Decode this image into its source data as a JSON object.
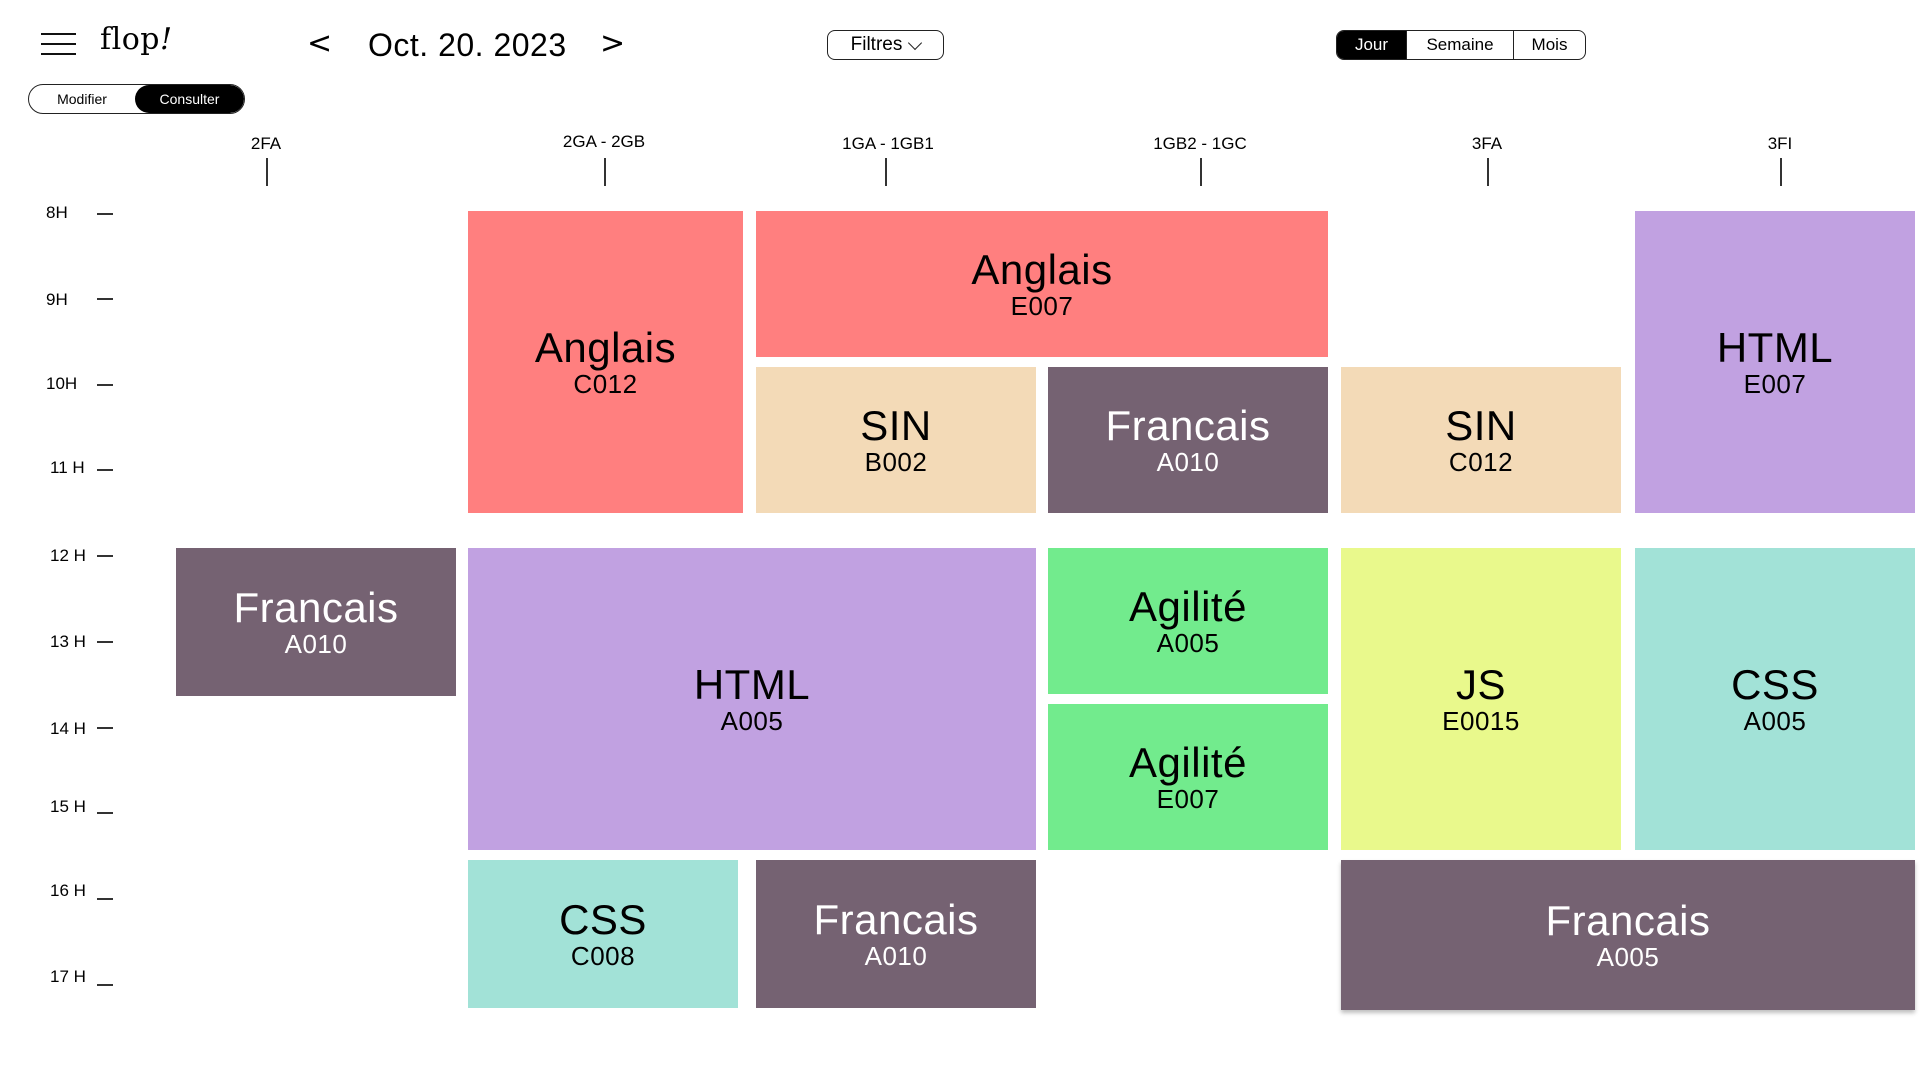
{
  "app": {
    "logo_text": "flop",
    "logo_mark": "!"
  },
  "header": {
    "prev_label": "<",
    "next_label": ">",
    "date": "Oct. 20. 2023",
    "filter_label": "Filtres",
    "views": {
      "day": "Jour",
      "week": "Semaine",
      "month": "Mois",
      "active": "Jour"
    },
    "modes": {
      "edit": "Modifier",
      "view": "Consulter",
      "active": "Consulter"
    }
  },
  "groups": [
    "2FA",
    "2GA - 2GB",
    "1GA - 1GB1",
    "1GB2 - 1GC",
    "3FA",
    "3FI"
  ],
  "hours": [
    "8H",
    "9H",
    "10H",
    "11 H",
    "12 H",
    "13 H",
    "14 H",
    "15 H",
    "16 H",
    "17 H"
  ],
  "events": [
    {
      "subject": "Anglais",
      "room": "C012",
      "group": "2GA - 2GB",
      "color": "#ff7f7f"
    },
    {
      "subject": "Anglais",
      "room": "E007",
      "group": "1GA - 1GB1, 1GB2 - 1GC",
      "color": "#ff7f7f"
    },
    {
      "subject": "HTML",
      "room": "E007",
      "group": "3FI",
      "color": "#c1a1e1"
    },
    {
      "subject": "SIN",
      "room": "B002",
      "group": "1GA - 1GB1",
      "color": "#f3dab7"
    },
    {
      "subject": "Francais",
      "room": "A010",
      "group": "1GB2 - 1GC",
      "color": "#756272"
    },
    {
      "subject": "SIN",
      "room": "C012",
      "group": "3FA",
      "color": "#f3dab7"
    },
    {
      "subject": "Francais",
      "room": "A010",
      "group": "2FA",
      "color": "#756272"
    },
    {
      "subject": "HTML",
      "room": "A005",
      "group": "2GA - 2GB, 1GA - 1GB1",
      "color": "#c1a1e1"
    },
    {
      "subject": "Agilité",
      "room": "A005",
      "group": "1GB2 - 1GC",
      "color": "#72eb8d"
    },
    {
      "subject": "Agilité",
      "room": "E007",
      "group": "1GB2 - 1GC",
      "color": "#72eb8d"
    },
    {
      "subject": "JS",
      "room": "E0015",
      "group": "3FA",
      "color": "#e9f98c"
    },
    {
      "subject": "CSS",
      "room": "A005",
      "group": "3FI",
      "color": "#a2e2d7"
    },
    {
      "subject": "CSS",
      "room": "C008",
      "group": "2GA - 2GB",
      "color": "#a2e2d7"
    },
    {
      "subject": "Francais",
      "room": "A010",
      "group": "1GA - 1GB1",
      "color": "#756272"
    },
    {
      "subject": "Francais",
      "room": "A005",
      "group": "3FA, 3FI",
      "color": "#756272"
    }
  ]
}
